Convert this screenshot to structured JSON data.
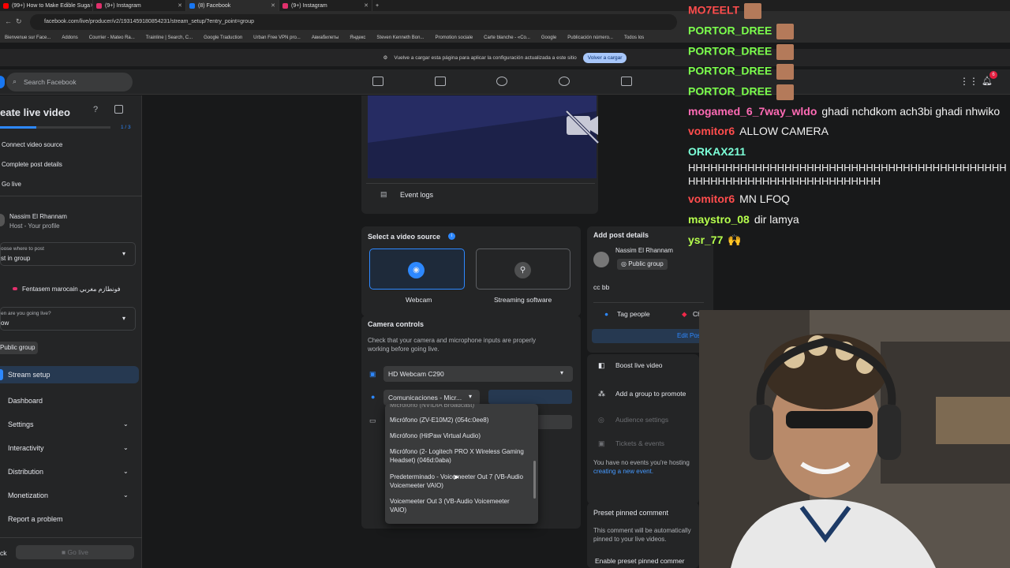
{
  "browser": {
    "tabs": [
      "(99+) How to Make Edible Suga",
      "(9+) Instagram",
      "(8) Facebook",
      "(9+) Instagram"
    ],
    "url": "facebook.com/live/producer/v2/1931459180854231/stream_setup/?entry_point=group",
    "bookmarks": [
      "Bienvenue sur Face...",
      "Addons",
      "Courrier - Mateo Ra...",
      "Trainline | Search, C...",
      "Google Traduction",
      "Urban Free VPN pro...",
      "Авиабилеты",
      "Яндекс",
      "Steven Kenneth Bon...",
      "Promotion sociale",
      "Carte blanche - «Co...",
      "Google",
      "Publicación número...",
      "Todos los"
    ],
    "infobar_text": "Vuelve a cargar esta página para aplicar la configuración actualizada a este sitio",
    "infobar_button": "Volver a cargar"
  },
  "fb": {
    "search_placeholder": "Search Facebook",
    "notification_count": "6"
  },
  "sidebar": {
    "title": "eate live video",
    "progress": "1 / 3",
    "progress_fraction": 0.33,
    "steps": [
      "Connect video source",
      "Complete post details",
      "Go live"
    ],
    "host_name": "Nassim El Rhannam",
    "host_role": "Host - Your profile",
    "post_where_label": "oose where to post",
    "post_where_value": "st in group",
    "group_name": "Fentasem marocain فونطازم مغربي",
    "going_live_label": "en are you going live?",
    "going_live_value": "ow",
    "public_group": "Public group",
    "menu": [
      "Stream setup",
      "Dashboard",
      "Settings",
      "Interactivity",
      "Distribution",
      "Monetization",
      "Report a problem"
    ],
    "back": "ck",
    "go_live": "Go live"
  },
  "main": {
    "event_logs": "Event logs",
    "video_source_title": "Select a video source",
    "webcam_label": "Webcam",
    "streaming_label": "Streaming software",
    "camera_controls_title": "Camera controls",
    "camera_controls_desc": "Check that your camera and microphone inputs are properly working before going live.",
    "camera_select": "HD Webcam C290",
    "mic_select": "Comunicaciones - Micr...",
    "dropdown_options": [
      "Micrófono (ZV-E10M2) (054c:0ee8)",
      "Micrófono (HitPaw Virtual Audio)",
      "Micrófono (2- Logitech PRO X Wireless Gaming Headset) (046d:0aba)",
      "Predeterminado - Voicemeeter Out 7 (VB-Audio Voicemeeter VAIO)",
      "Voicemeeter Out 3 (VB-Audio Voicemeeter VAIO)"
    ]
  },
  "post": {
    "title": "Add post details",
    "name": "Nassim El Rhannam",
    "audience": "Public group",
    "text": "cc bb",
    "tag_people": "Tag people",
    "check_in": "Check in",
    "edit_post": "Edit Post",
    "boost": "Boost live video",
    "add_group": "Add a group to promote",
    "audience_settings": "Audience settings",
    "tickets": "Tickets & events",
    "events_text": "You have no events you're hosting",
    "events_link": "creating a new event.",
    "preset_title": "Preset pinned comment",
    "preset_desc": "This comment will be automatically pinned to your live videos.",
    "enable_preset": "Enable preset pinned commer"
  },
  "chat": [
    {
      "user": "MO7EELT",
      "msg": "",
      "color": "#ff4d4d"
    },
    {
      "user": "PORTOR_DREE",
      "msg": "",
      "color": "#7cff4d"
    },
    {
      "user": "PORTOR_DREE",
      "msg": "",
      "color": "#7cff4d"
    },
    {
      "user": "PORTOR_DREE",
      "msg": "",
      "color": "#7cff4d"
    },
    {
      "user": "PORTOR_DREE",
      "msg": "",
      "color": "#7cff4d"
    },
    {
      "user": "mogamed_6_7way_wldo",
      "msg": "ghadi nchdkom ach3bi ghadi nhwiko",
      "color": "#ff6bb5"
    },
    {
      "user": "vomitor6",
      "msg": "ALLOW CAMERA",
      "color": "#ff4d4d"
    },
    {
      "user": "ORKAX211",
      "msg": "",
      "color": "#7cffd8"
    },
    {
      "user": "",
      "msg": "HHHHHHHHHHHHHHHHHHHHHHHHHHHHHHHHHHHHHHHHHHHHHHHHHHHHHHHHHHHHHHHHHHHHH",
      "color": "#f2f2f2"
    },
    {
      "user": "vomitor6",
      "msg": "MN LFOQ",
      "color": "#ff4d4d"
    },
    {
      "user": "maystro_08",
      "msg": "dir lamya",
      "color": "#b6ff4d"
    },
    {
      "user": "ysr_77",
      "msg": "🙌",
      "color": "#b6ff4d"
    }
  ]
}
